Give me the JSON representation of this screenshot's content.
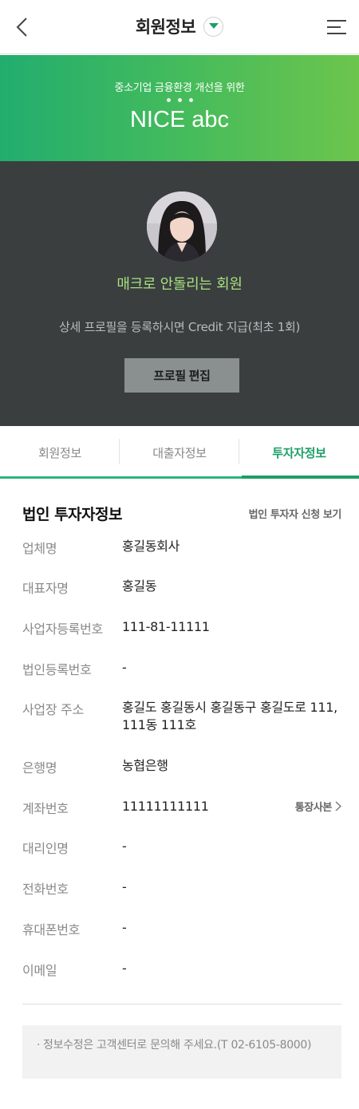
{
  "header": {
    "title": "회원정보",
    "back_icon": "chevron-left-icon",
    "menu_icon": "hamburger-menu-icon"
  },
  "banner": {
    "subtitle": "중소기업 금융환경 개선을 위한",
    "title": "NICE abc",
    "colors": {
      "from": "#22ad6f",
      "to": "#6cc54c"
    }
  },
  "profile": {
    "nickname": "매크로 안돌리는 회원",
    "description": "상세 프로필을 등록하시면 Credit 지급(최초 1회)",
    "edit_button": "프로필 편집"
  },
  "tabs": [
    {
      "label": "회원정보",
      "active": false
    },
    {
      "label": "대출자정보",
      "active": false
    },
    {
      "label": "투자자정보",
      "active": true
    }
  ],
  "investor": {
    "section_title": "법인 투자자정보",
    "section_link": "법인 투자자 신청 보기",
    "rows": [
      {
        "label": "업체명",
        "value": "홍길동회사"
      },
      {
        "label": "대표자명",
        "value": "홍길동"
      },
      {
        "label": "사업자등록번호",
        "value": "111-81-11111"
      },
      {
        "label": "법인등록번호",
        "value": "-"
      },
      {
        "label": "사업장 주소",
        "value": "홍길도 홍길동시 홍길동구 홍길도로 111, 111동 111호"
      },
      {
        "label": "은행명",
        "value": "농협은행"
      },
      {
        "label": "계좌번호",
        "value": "11111111111",
        "extra": "통장사본"
      },
      {
        "label": "대리인명",
        "value": "-"
      },
      {
        "label": "전화번호",
        "value": "-"
      },
      {
        "label": "휴대폰번호",
        "value": "-"
      },
      {
        "label": "이메일",
        "value": "-"
      }
    ]
  },
  "notice": {
    "bullet": "·",
    "text": "정보수정은 고객센터로 문의해 주세요.(T 02-6105-8000)"
  },
  "colors": {
    "accent": "#1f9e68",
    "dark_bg": "#3a3e3f",
    "nickname": "#a6e07f"
  }
}
